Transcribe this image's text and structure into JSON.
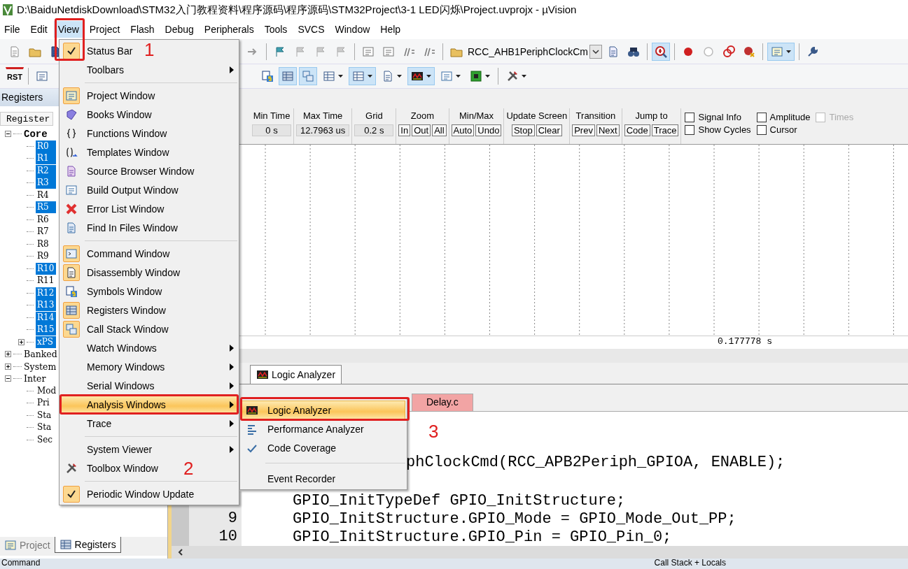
{
  "window": {
    "title": "D:\\BaiduNetdiskDownload\\STM32入门教程资料\\程序源码\\程序源码\\STM32Project\\3-1 LED闪烁\\Project.uvprojx - µVision"
  },
  "menu_bar": [
    {
      "label": "File",
      "selected": false
    },
    {
      "label": "Edit",
      "selected": false
    },
    {
      "label": "View",
      "selected": true
    },
    {
      "label": "Project",
      "selected": false
    },
    {
      "label": "Flash",
      "selected": false
    },
    {
      "label": "Debug",
      "selected": false
    },
    {
      "label": "Peripherals",
      "selected": false
    },
    {
      "label": "Tools",
      "selected": false
    },
    {
      "label": "SVCS",
      "selected": false
    },
    {
      "label": "Window",
      "selected": false
    },
    {
      "label": "Help",
      "selected": false
    }
  ],
  "toolbar": {
    "function_combo": "RCC_AHB1PeriphClockCm",
    "reset_label": "RST"
  },
  "registers_panel": {
    "title": "Registers",
    "column": "Register",
    "tree": [
      {
        "label": "Core",
        "expanded": true,
        "children": [
          {
            "label": "R0",
            "selected": true
          },
          {
            "label": "R1",
            "selected": true
          },
          {
            "label": "R2",
            "selected": true
          },
          {
            "label": "R3",
            "selected": true
          },
          {
            "label": "R4",
            "selected": false
          },
          {
            "label": "R5",
            "selected": true
          },
          {
            "label": "R6",
            "selected": false
          },
          {
            "label": "R7",
            "selected": false
          },
          {
            "label": "R8",
            "selected": false
          },
          {
            "label": "R9",
            "selected": false
          },
          {
            "label": "R10",
            "selected": true
          },
          {
            "label": "R11",
            "selected": false
          },
          {
            "label": "R12",
            "selected": true
          },
          {
            "label": "R13",
            "selected": true
          },
          {
            "label": "R14",
            "selected": true
          },
          {
            "label": "R15",
            "selected": true
          },
          {
            "label": "xPS",
            "selected": true,
            "expanded": false
          }
        ]
      },
      {
        "label": "Banked",
        "expanded": false
      },
      {
        "label": "System",
        "expanded": false
      },
      {
        "label": "Inter",
        "expanded": true,
        "children": [
          {
            "label": "Mod",
            "selected": false
          },
          {
            "label": "Pri",
            "selected": false
          },
          {
            "label": "Sta",
            "selected": false
          },
          {
            "label": "Sta",
            "selected": false
          },
          {
            "label": "Sec",
            "selected": false
          }
        ]
      }
    ]
  },
  "panel_tabs": [
    {
      "label": "Project",
      "selected": false
    },
    {
      "label": "Registers",
      "selected": true
    }
  ],
  "logic_analyzer": {
    "fields": [
      {
        "label": "Min Time",
        "value": "0 s"
      },
      {
        "label": "Max Time",
        "value": "12.7963 us"
      },
      {
        "label": "Grid",
        "value": "0.2 s"
      }
    ],
    "groups": [
      {
        "label": "Zoom",
        "buttons": [
          "In",
          "Out",
          "All"
        ]
      },
      {
        "label": "Min/Max",
        "buttons": [
          "Auto",
          "Undo"
        ]
      },
      {
        "label": "Update Screen",
        "buttons": [
          "Stop",
          "Clear"
        ]
      },
      {
        "label": "Transition",
        "buttons": [
          "Prev",
          "Next"
        ]
      },
      {
        "label": "Jump to",
        "buttons": [
          "Code",
          "Trace"
        ]
      }
    ],
    "options": [
      {
        "label": "Signal Info",
        "checked": false,
        "disabled": false
      },
      {
        "label": "Amplitude",
        "checked": false,
        "disabled": false
      },
      {
        "label": "Times",
        "checked": false,
        "disabled": true
      },
      {
        "label": "Show Cycles",
        "checked": false,
        "disabled": false
      },
      {
        "label": "Cursor",
        "checked": false,
        "disabled": false
      }
    ],
    "cursor_time": "0.177778 s"
  },
  "window_tabs": [
    {
      "label": "Logic Analyzer",
      "selected": true
    }
  ],
  "editor": {
    "tabs": [
      {
        "label": "Delay.c",
        "selected": true
      }
    ],
    "lines": [
      {
        "text": "phClockCmd(RCC_APB2Periph_GPIOA, ENABLE);"
      },
      {
        "text": "GPIO_InitTypeDef GPIO_InitStructure;"
      },
      {
        "number": "9",
        "text": "GPIO_InitStructure.GPIO_Mode = GPIO_Mode_Out_PP;"
      },
      {
        "number": "10",
        "text": "GPIO_InitStructure.GPIO_Pin = GPIO_Pin_0;"
      }
    ]
  },
  "bottom_panels": [
    {
      "label": "Command"
    },
    {
      "label": "Call Stack + Locals"
    }
  ],
  "view_menu": [
    {
      "kind": "item",
      "label": "Status Bar",
      "checked": true,
      "has_submenu": false,
      "selected": false
    },
    {
      "kind": "item",
      "label": "Toolbars",
      "checked": false,
      "has_submenu": true,
      "selected": false
    },
    {
      "kind": "separator"
    },
    {
      "kind": "item",
      "label": "Project Window",
      "checked": true,
      "has_submenu": false,
      "selected": false
    },
    {
      "kind": "item",
      "label": "Books Window",
      "checked": false,
      "has_submenu": false,
      "selected": false
    },
    {
      "kind": "item",
      "label": "Functions Window",
      "checked": false,
      "has_submenu": false,
      "selected": false
    },
    {
      "kind": "item",
      "label": "Templates Window",
      "checked": false,
      "has_submenu": false,
      "selected": false
    },
    {
      "kind": "item",
      "label": "Source Browser Window",
      "checked": false,
      "has_submenu": false,
      "selected": false
    },
    {
      "kind": "item",
      "label": "Build Output Window",
      "checked": false,
      "has_submenu": false,
      "selected": false
    },
    {
      "kind": "item",
      "label": "Error List Window",
      "checked": false,
      "has_submenu": false,
      "selected": false
    },
    {
      "kind": "item",
      "label": "Find In Files Window",
      "checked": false,
      "has_submenu": false,
      "selected": false
    },
    {
      "kind": "separator"
    },
    {
      "kind": "item",
      "label": "Command Window",
      "checked": true,
      "has_submenu": false,
      "selected": false
    },
    {
      "kind": "item",
      "label": "Disassembly Window",
      "checked": true,
      "has_submenu": false,
      "selected": false
    },
    {
      "kind": "item",
      "label": "Symbols Window",
      "checked": false,
      "has_submenu": false,
      "selected": false
    },
    {
      "kind": "item",
      "label": "Registers Window",
      "checked": true,
      "has_submenu": false,
      "selected": false
    },
    {
      "kind": "item",
      "label": "Call Stack Window",
      "checked": true,
      "has_submenu": false,
      "selected": false
    },
    {
      "kind": "item",
      "label": "Watch Windows",
      "checked": false,
      "has_submenu": true,
      "selected": false
    },
    {
      "kind": "item",
      "label": "Memory Windows",
      "checked": false,
      "has_submenu": true,
      "selected": false
    },
    {
      "kind": "item",
      "label": "Serial Windows",
      "checked": false,
      "has_submenu": true,
      "selected": false
    },
    {
      "kind": "item",
      "label": "Analysis Windows",
      "checked": false,
      "has_submenu": true,
      "selected": true
    },
    {
      "kind": "item",
      "label": "Trace",
      "checked": false,
      "has_submenu": true,
      "selected": false
    },
    {
      "kind": "separator"
    },
    {
      "kind": "item",
      "label": "System Viewer",
      "checked": false,
      "has_submenu": true,
      "selected": false
    },
    {
      "kind": "item",
      "label": "Toolbox Window",
      "checked": false,
      "has_submenu": false,
      "selected": false
    },
    {
      "kind": "separator"
    },
    {
      "kind": "item",
      "label": "Periodic Window Update",
      "checked": true,
      "has_submenu": false,
      "selected": false
    }
  ],
  "analysis_submenu": [
    {
      "kind": "item",
      "label": "Logic Analyzer",
      "selected": true
    },
    {
      "kind": "item",
      "label": "Performance Analyzer",
      "selected": false
    },
    {
      "kind": "item",
      "label": "Code Coverage",
      "selected": false
    },
    {
      "kind": "separator"
    },
    {
      "kind": "item",
      "label": "Event Recorder",
      "selected": false
    }
  ],
  "annotations": [
    {
      "label": "1"
    },
    {
      "label": "2"
    },
    {
      "label": "3"
    }
  ]
}
